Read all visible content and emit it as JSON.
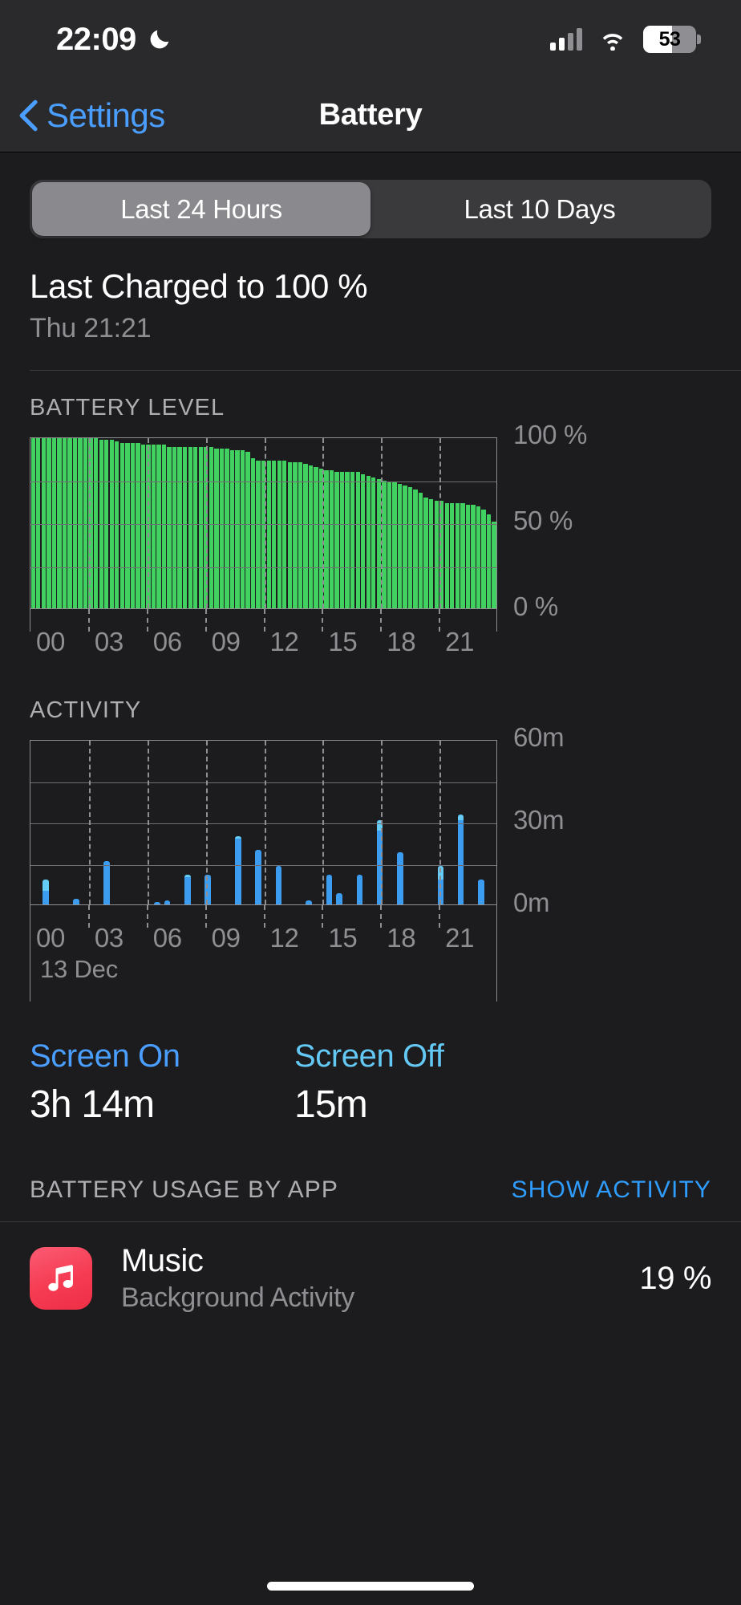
{
  "status_bar": {
    "time": "22:09",
    "moon_icon": "crescent-moon-icon",
    "cellular_icon": "cellular-bars-icon",
    "wifi_icon": "wifi-icon",
    "battery_percent_label": "53",
    "battery_fill_percent": 53
  },
  "nav": {
    "back_label": "Settings",
    "back_icon": "chevron-left-icon",
    "title": "Battery"
  },
  "segmented_control": {
    "options": [
      "Last 24 Hours",
      "Last 10 Days"
    ],
    "selected_index": 0
  },
  "last_charged": {
    "title": "Last Charged to 100 %",
    "subtitle": "Thu 21:21"
  },
  "screen_time": {
    "screen_on_label": "Screen On",
    "screen_on_value": "3h 14m",
    "screen_off_label": "Screen Off",
    "screen_off_value": "15m"
  },
  "usage_section": {
    "title": "BATTERY USAGE BY APP",
    "action": "SHOW ACTIVITY",
    "apps": [
      {
        "name": "Music",
        "subtitle": "Background Activity",
        "percent": "19 %",
        "icon": "music-note-icon",
        "icon_color": "#f53b52"
      }
    ]
  },
  "colors": {
    "accent_blue": "#4a9eff",
    "battery_green": "#41d161",
    "activity_blue_dark": "#3c9cf0",
    "activity_blue_light": "#65ccf7",
    "background": "#1c1c1e",
    "chrome": "#2a2a2c",
    "secondary_text": "#8e8e93"
  },
  "chart_data": [
    {
      "type": "bar",
      "id": "battery-level-chart",
      "title": "BATTERY LEVEL",
      "xlabel": "",
      "ylabel": "",
      "ylim": [
        0,
        100
      ],
      "ytick_labels": [
        "100 %",
        "50 %",
        "0 %"
      ],
      "yticks": [
        100,
        50,
        0
      ],
      "xtick_labels": [
        "00",
        "03",
        "06",
        "09",
        "12",
        "15",
        "18",
        "21"
      ],
      "xticks": [
        0,
        3,
        6,
        9,
        12,
        15,
        18,
        21
      ],
      "grid": true,
      "day_label": "",
      "series_color": "#41d161",
      "x": [
        0.0,
        0.25,
        0.5,
        0.75,
        1.0,
        1.25,
        1.5,
        1.75,
        2.0,
        2.25,
        2.5,
        2.75,
        3.0,
        3.25,
        3.5,
        3.75,
        4.0,
        4.25,
        4.5,
        4.75,
        5.0,
        5.25,
        5.5,
        5.75,
        6.0,
        6.25,
        6.5,
        6.75,
        7.0,
        7.25,
        7.5,
        7.75,
        8.0,
        8.25,
        8.5,
        8.75,
        9.0,
        9.25,
        9.5,
        9.75,
        10.0,
        10.25,
        10.5,
        10.75,
        11.0,
        11.25,
        11.5,
        11.75,
        12.0,
        12.25,
        12.5,
        12.75,
        13.0,
        13.25,
        13.5,
        13.75,
        14.0,
        14.25,
        14.5,
        14.75,
        15.0,
        15.25,
        15.5,
        15.75,
        16.0,
        16.25,
        16.5,
        16.75,
        17.0,
        17.25,
        17.5,
        17.75,
        18.0,
        18.25,
        18.5,
        18.75,
        19.0,
        19.25,
        19.5,
        19.75,
        20.0,
        20.25,
        20.5,
        20.75,
        21.0,
        21.25,
        21.5,
        21.75,
        22.0
      ],
      "values": [
        100,
        100,
        100,
        100,
        100,
        100,
        100,
        100,
        100,
        100,
        100,
        100,
        100,
        99,
        99,
        99,
        98,
        97,
        97,
        97,
        97,
        96,
        96,
        96,
        96,
        96,
        95,
        95,
        95,
        95,
        95,
        95,
        95,
        95,
        95,
        94,
        94,
        94,
        93,
        93,
        93,
        92,
        88,
        87,
        87,
        87,
        87,
        87,
        87,
        86,
        86,
        86,
        85,
        84,
        83,
        82,
        81,
        81,
        80,
        80,
        80,
        80,
        80,
        79,
        78,
        77,
        76,
        75,
        74,
        74,
        73,
        72,
        71,
        70,
        68,
        65,
        64,
        63,
        63,
        62,
        62,
        62,
        62,
        61,
        61,
        60,
        58,
        55,
        51
      ]
    },
    {
      "type": "bar",
      "id": "activity-chart",
      "title": "ACTIVITY",
      "xlabel": "",
      "ylabel": "",
      "ylim": [
        0,
        60
      ],
      "ytick_labels": [
        "60m",
        "30m",
        "0m"
      ],
      "yticks": [
        60,
        30,
        0
      ],
      "xtick_labels": [
        "00",
        "03",
        "06",
        "09",
        "12",
        "15",
        "18",
        "21"
      ],
      "xticks": [
        0,
        3,
        6,
        9,
        12,
        15,
        18,
        21
      ],
      "grid": true,
      "day_label": "13 Dec",
      "stacked": true,
      "series": [
        {
          "name": "Screen Off",
          "color": "#3c9cf0",
          "values": [
            0,
            5,
            0,
            0,
            2,
            0,
            0,
            16,
            0,
            0,
            0,
            0,
            1,
            1.5,
            0,
            10,
            0,
            11,
            0,
            0,
            24,
            0,
            20,
            0,
            14,
            0,
            0,
            1.5,
            0,
            11,
            4,
            0,
            11,
            0,
            27,
            0,
            19,
            0,
            0,
            0,
            9,
            0,
            31,
            0,
            9,
            0
          ]
        },
        {
          "name": "Screen On",
          "color": "#65ccf7",
          "values": [
            0,
            4,
            0,
            0,
            0,
            0,
            0,
            0,
            0,
            0,
            0,
            0,
            0,
            0,
            0,
            1,
            0,
            0,
            0,
            0,
            1,
            0,
            0,
            0,
            0,
            0,
            0,
            0,
            0,
            0,
            0,
            0,
            0,
            0,
            4,
            0,
            0,
            0,
            0,
            0,
            5,
            0,
            2,
            0,
            0,
            0
          ]
        }
      ]
    }
  ]
}
